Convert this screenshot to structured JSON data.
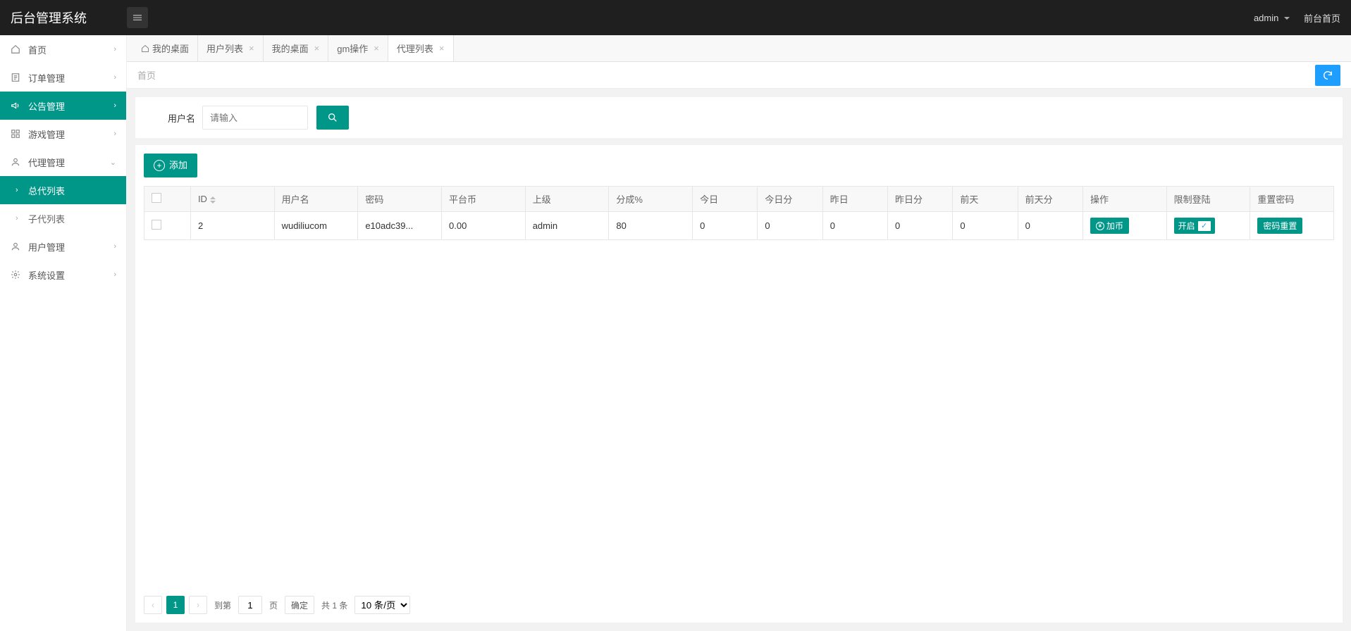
{
  "header": {
    "logo": "后台管理系统",
    "admin_label": "admin",
    "front_link": "前台首页"
  },
  "sidebar": {
    "items": [
      {
        "label": "首页",
        "icon": "home",
        "arrow": "right"
      },
      {
        "label": "订单管理",
        "icon": "order",
        "arrow": "right"
      },
      {
        "label": "公告管理",
        "icon": "announce",
        "arrow": "right",
        "active": true
      },
      {
        "label": "游戏管理",
        "icon": "game",
        "arrow": "right"
      },
      {
        "label": "代理管理",
        "icon": "agent",
        "arrow": "down",
        "expanded": true
      },
      {
        "label": "用户管理",
        "icon": "user",
        "arrow": "right"
      },
      {
        "label": "系统设置",
        "icon": "settings",
        "arrow": "right"
      }
    ],
    "agent_sub": [
      {
        "label": "总代列表",
        "active": true
      },
      {
        "label": "子代列表"
      }
    ]
  },
  "tabs": {
    "items": [
      {
        "label": "我的桌面",
        "home": true
      },
      {
        "label": "用户列表",
        "closable": true
      },
      {
        "label": "我的桌面",
        "closable": true
      },
      {
        "label": "gm操作",
        "closable": true
      },
      {
        "label": "代理列表",
        "closable": true,
        "active": true
      }
    ]
  },
  "breadcrumb": {
    "text": "首页"
  },
  "search": {
    "label": "用户名",
    "placeholder": "请输入"
  },
  "toolbar": {
    "add_label": "添加"
  },
  "table": {
    "columns": [
      "",
      "ID",
      "用户名",
      "密码",
      "平台币",
      "上级",
      "分成%",
      "今日",
      "今日分",
      "昨日",
      "昨日分",
      "前天",
      "前天分",
      "操作",
      "限制登陆",
      "重置密码"
    ],
    "rows": [
      {
        "id": "2",
        "username": "wudiliucom",
        "password": "e10adc39...",
        "coins": "0.00",
        "parent": "admin",
        "share": "80",
        "today": "0",
        "today_share": "0",
        "yesterday": "0",
        "yesterday_share": "0",
        "daybefore": "0",
        "daybefore_share": "0",
        "op_label": "加币",
        "limit_label": "开启",
        "reset_label": "密码重置"
      }
    ]
  },
  "pagination": {
    "current": "1",
    "goto_label": "到第",
    "page_input": "1",
    "page_suffix": "页",
    "confirm": "确定",
    "total": "共 1 条",
    "per_page": "10 条/页"
  }
}
